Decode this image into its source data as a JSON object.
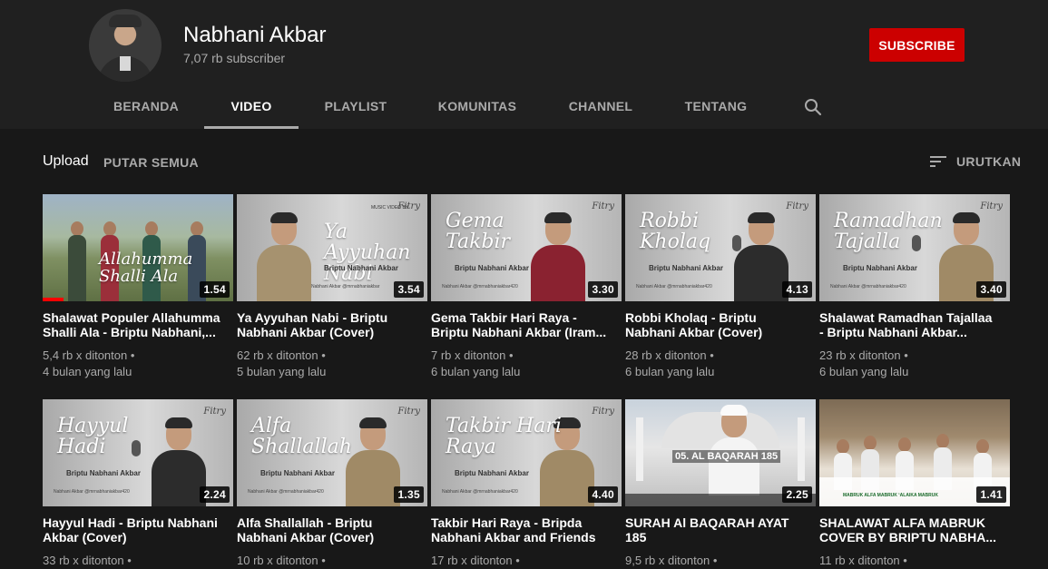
{
  "channel": {
    "name": "Nabhani Akbar",
    "subscribers": "7,07 rb subscriber",
    "subscribe_label": "SUBSCRIBE"
  },
  "tabs": [
    {
      "label": "BERANDA"
    },
    {
      "label": "VIDEO",
      "active": true
    },
    {
      "label": "PLAYLIST"
    },
    {
      "label": "KOMUNITAS"
    },
    {
      "label": "CHANNEL"
    },
    {
      "label": "TENTANG"
    }
  ],
  "section": {
    "title": "Upload",
    "play_all": "PUTAR SEMUA",
    "sort_label": "URUTKAN"
  },
  "videos": [
    {
      "thumb_text": "Allahumma Shalli Ala",
      "duration": "1.54",
      "progress": 0.11,
      "title_1": "Shalawat Populer Allahumma",
      "title_2": "Shalli Ala - Briptu Nabhani,...",
      "views": "5,4 rb x ditonton •",
      "age": "4 bulan yang lalu"
    },
    {
      "thumb_text": "Ya Ayyuhan Nabi",
      "thumb_sub": "Briptu Nabhani Akbar",
      "thumb_foot": "Nabhani Akbar   @mrnabhaniakbar",
      "thumb_logo": "Fitry",
      "thumb_top": "MUSIC VIDEO BY",
      "duration": "3.54",
      "title_1": "Ya Ayyuhan Nabi - Briptu",
      "title_2": "Nabhani Akbar (Cover)",
      "views": "62 rb x ditonton •",
      "age": "5 bulan yang lalu"
    },
    {
      "thumb_text": "Gema Takbir",
      "thumb_sub": "Briptu Nabhani Akbar",
      "thumb_foot": "Nabhani Akbar   @mrnabhaniakbar420",
      "thumb_logo": "Fitry",
      "duration": "3.30",
      "title_1": "Gema Takbir Hari Raya -",
      "title_2": "Briptu Nabhani Akbar (Iram...",
      "views": "7 rb x ditonton •",
      "age": "6 bulan yang lalu"
    },
    {
      "thumb_text": "Robbi Kholaq",
      "thumb_sub": "Briptu Nabhani Akbar",
      "thumb_foot": "Nabhani Akbar   @mrnabhaniakbar420",
      "thumb_logo": "Fitry",
      "duration": "4.13",
      "title_1": "Robbi Kholaq - Briptu",
      "title_2": "Nabhani Akbar (Cover)",
      "views": "28 rb x ditonton •",
      "age": "6 bulan yang lalu"
    },
    {
      "thumb_text": "Ramadhan Tajalla",
      "thumb_sub": "Briptu Nabhani Akbar",
      "thumb_foot": "Nabhani Akbar   @mrnabhaniakbar420",
      "thumb_logo": "Fitry",
      "duration": "3.40",
      "title_1": "Shalawat Ramadhan Tajallaa",
      "title_2": "- Briptu Nabhani Akbar...",
      "views": "23 rb x ditonton •",
      "age": "6 bulan yang lalu"
    },
    {
      "thumb_text": "Hayyul Hadi",
      "thumb_sub": "Briptu Nabhani Akbar",
      "thumb_foot": "Nabhani Akbar   @mrnabhaniakbar420",
      "thumb_logo": "Fitry",
      "duration": "2.24",
      "title_1": "Hayyul Hadi - Briptu Nabhani",
      "title_2": "Akbar (Cover)",
      "views": "33 rb x ditonton •",
      "age": ""
    },
    {
      "thumb_text": "Alfa Shallallah",
      "thumb_sub": "Briptu Nabhani Akbar",
      "thumb_foot": "Nabhani Akbar   @mrnabhaniakbar420",
      "thumb_logo": "Fitry",
      "duration": "1.35",
      "title_1": "Alfa Shallallah - Briptu",
      "title_2": "Nabhani Akbar (Cover)",
      "views": "10 rb x ditonton •",
      "age": ""
    },
    {
      "thumb_text": "Takbir Hari Raya",
      "thumb_sub": "Briptu Nabhani Akbar",
      "thumb_foot": "Nabhani Akbar   @mrnabhaniakbar420",
      "thumb_logo": "Fitry",
      "duration": "4.40",
      "title_1": "Takbir Hari Raya - Bripda",
      "title_2": "Nabhani Akbar and Friends",
      "views": "17 rb x ditonton •",
      "age": ""
    },
    {
      "thumb_text": "05. AL BAQARAH 185",
      "duration": "2.25",
      "title_1": "SURAH Al BAQARAH AYAT",
      "title_2": "185",
      "views": "9,5 rb x ditonton •",
      "age": ""
    },
    {
      "thumb_text": "MABRUK ALFA MABRUK ‘ALAIKA MABRUK",
      "duration": "1.41",
      "title_1": "SHALAWAT ALFA MABRUK",
      "title_2": "COVER BY BRIPTU NABHA...",
      "views": "11 rb x ditonton •",
      "age": ""
    }
  ]
}
